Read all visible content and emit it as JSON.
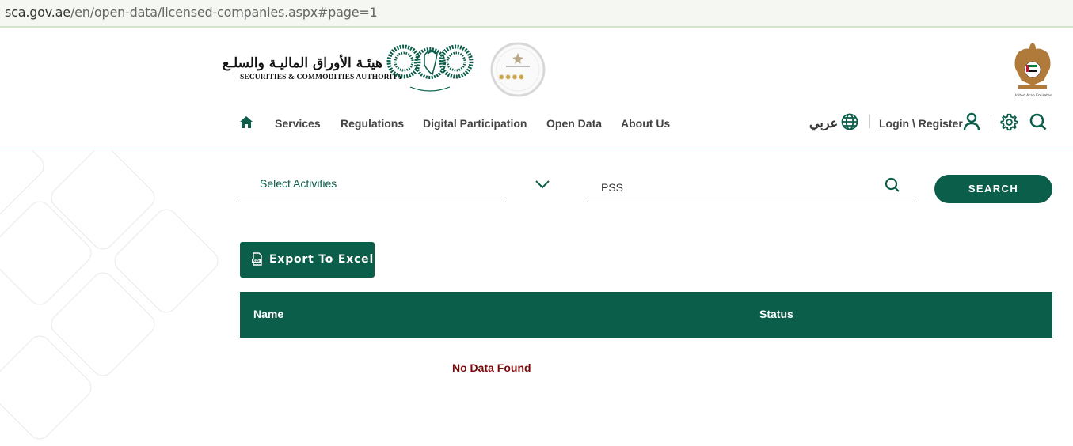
{
  "browser": {
    "url_domain": "sca.gov.ae",
    "url_path": "/en/open-data/licensed-companies.aspx#page=1"
  },
  "brand": {
    "name_ar": "هيئـة الأوراق الماليـة والسلـع",
    "name_en": "SECURITIES & COMMODITIES AUTHORITY",
    "accent_color": "#0b5e4a",
    "error_color": "#7a0a0a"
  },
  "nav": {
    "home_icon": "home-icon",
    "items": [
      "Services",
      "Regulations",
      "Digital Participation",
      "Open Data",
      "About Us"
    ],
    "language": "عربي",
    "login": "Login \\ Register"
  },
  "filters": {
    "activity_select": "Select Activities",
    "search_value": "PSS",
    "search_button": "SEARCH"
  },
  "actions": {
    "export": "Export To Excel"
  },
  "table": {
    "columns": [
      "Name",
      "Status"
    ],
    "empty_message": "No Data Found"
  }
}
